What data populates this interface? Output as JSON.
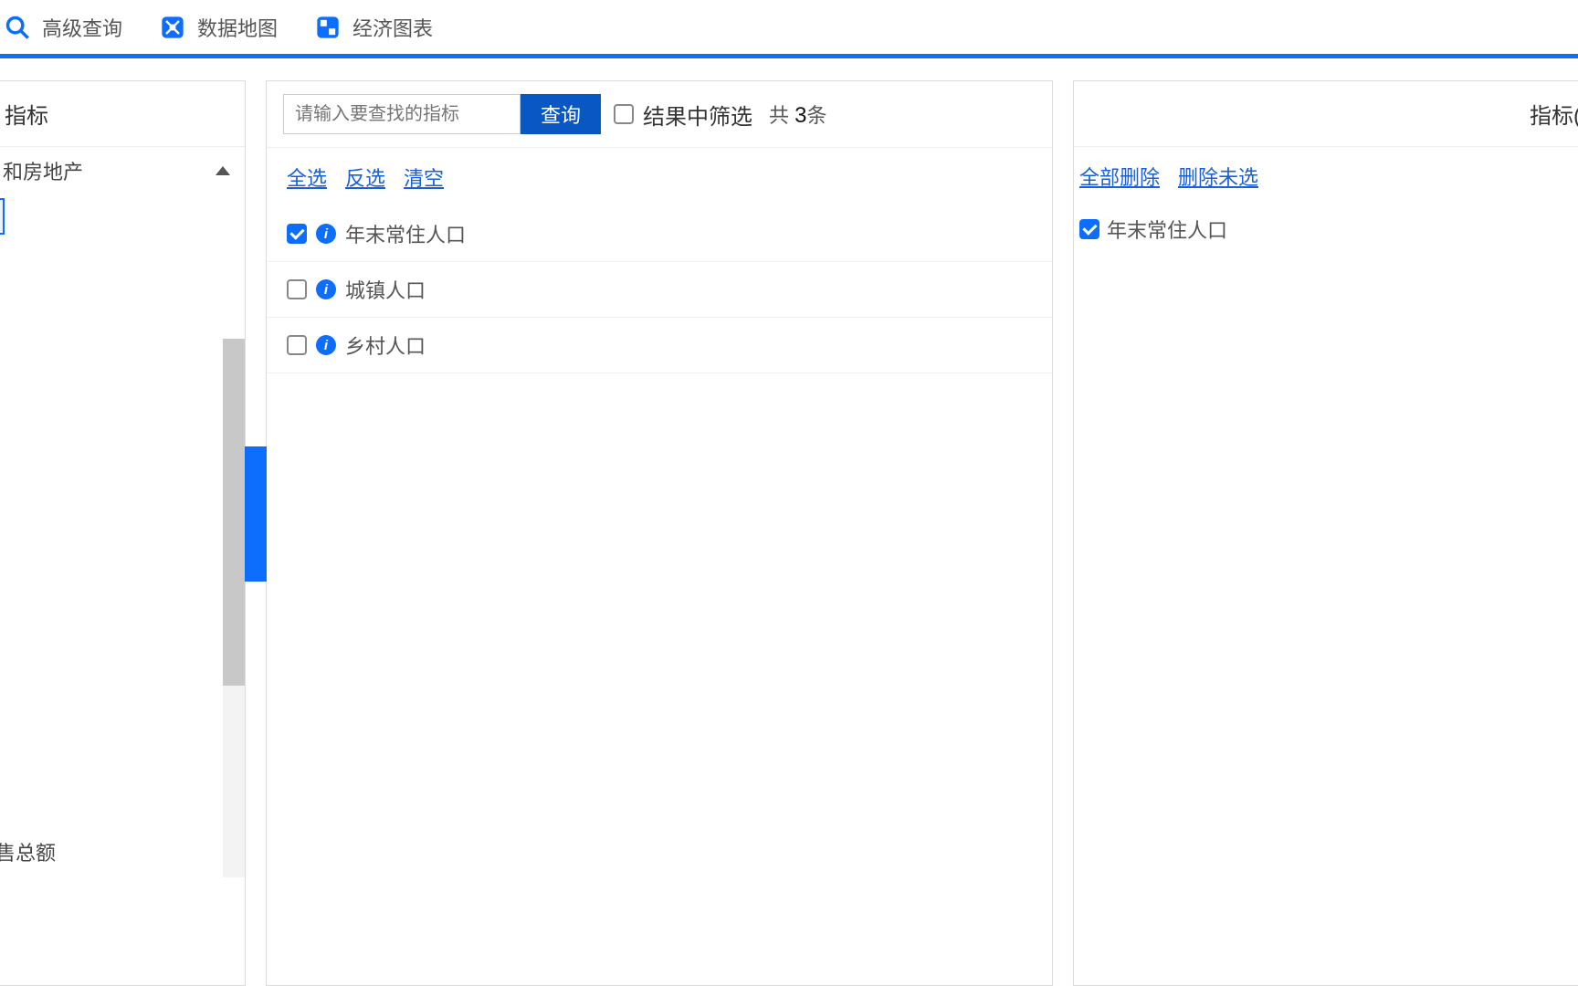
{
  "topbar": {
    "items": [
      {
        "label": "高级查询"
      },
      {
        "label": "数据地图"
      },
      {
        "label": "经济图表"
      }
    ]
  },
  "left": {
    "title": "指标",
    "tree_item": "和房地产",
    "bottom_item": "售总额"
  },
  "mid": {
    "search_placeholder": "请输入要查找的指标",
    "search_button": "查询",
    "filter_label": "结果中筛选",
    "count_prefix": "共 ",
    "count_value": "3",
    "count_suffix": "条",
    "links": {
      "select_all": "全选",
      "invert": "反选",
      "clear": "清空"
    },
    "items": [
      {
        "label": "年末常住人口",
        "checked": true
      },
      {
        "label": "城镇人口",
        "checked": false
      },
      {
        "label": "乡村人口",
        "checked": false
      }
    ]
  },
  "right": {
    "title": "指标(",
    "links": {
      "delete_all": "全部删除",
      "delete_unselected": "删除未选"
    },
    "items": [
      {
        "label": "年末常住人口",
        "checked": true
      }
    ]
  }
}
